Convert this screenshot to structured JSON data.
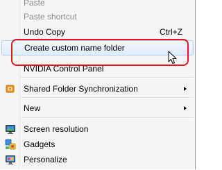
{
  "menu": {
    "items": [
      {
        "label": "Paste",
        "disabled": true
      },
      {
        "label": "Paste shortcut",
        "disabled": true
      },
      {
        "label": "Undo Copy",
        "shortcut": "Ctrl+Z"
      },
      {
        "label": "Create custom name folder",
        "highlighted": true
      },
      {
        "label": "NVIDIA Control Panel"
      },
      {
        "label": "Shared Folder Synchronization",
        "icon": "sync-icon",
        "submenu": true
      },
      {
        "label": "New",
        "submenu": true
      },
      {
        "label": "Screen resolution",
        "icon": "monitor-icon"
      },
      {
        "label": "Gadgets",
        "icon": "gadgets-icon"
      },
      {
        "label": "Personalize",
        "icon": "personalize-icon"
      }
    ]
  },
  "colors": {
    "annotation": "#e8141c",
    "hover_border": "#aecff7",
    "disabled_text": "#8d8d8d"
  }
}
